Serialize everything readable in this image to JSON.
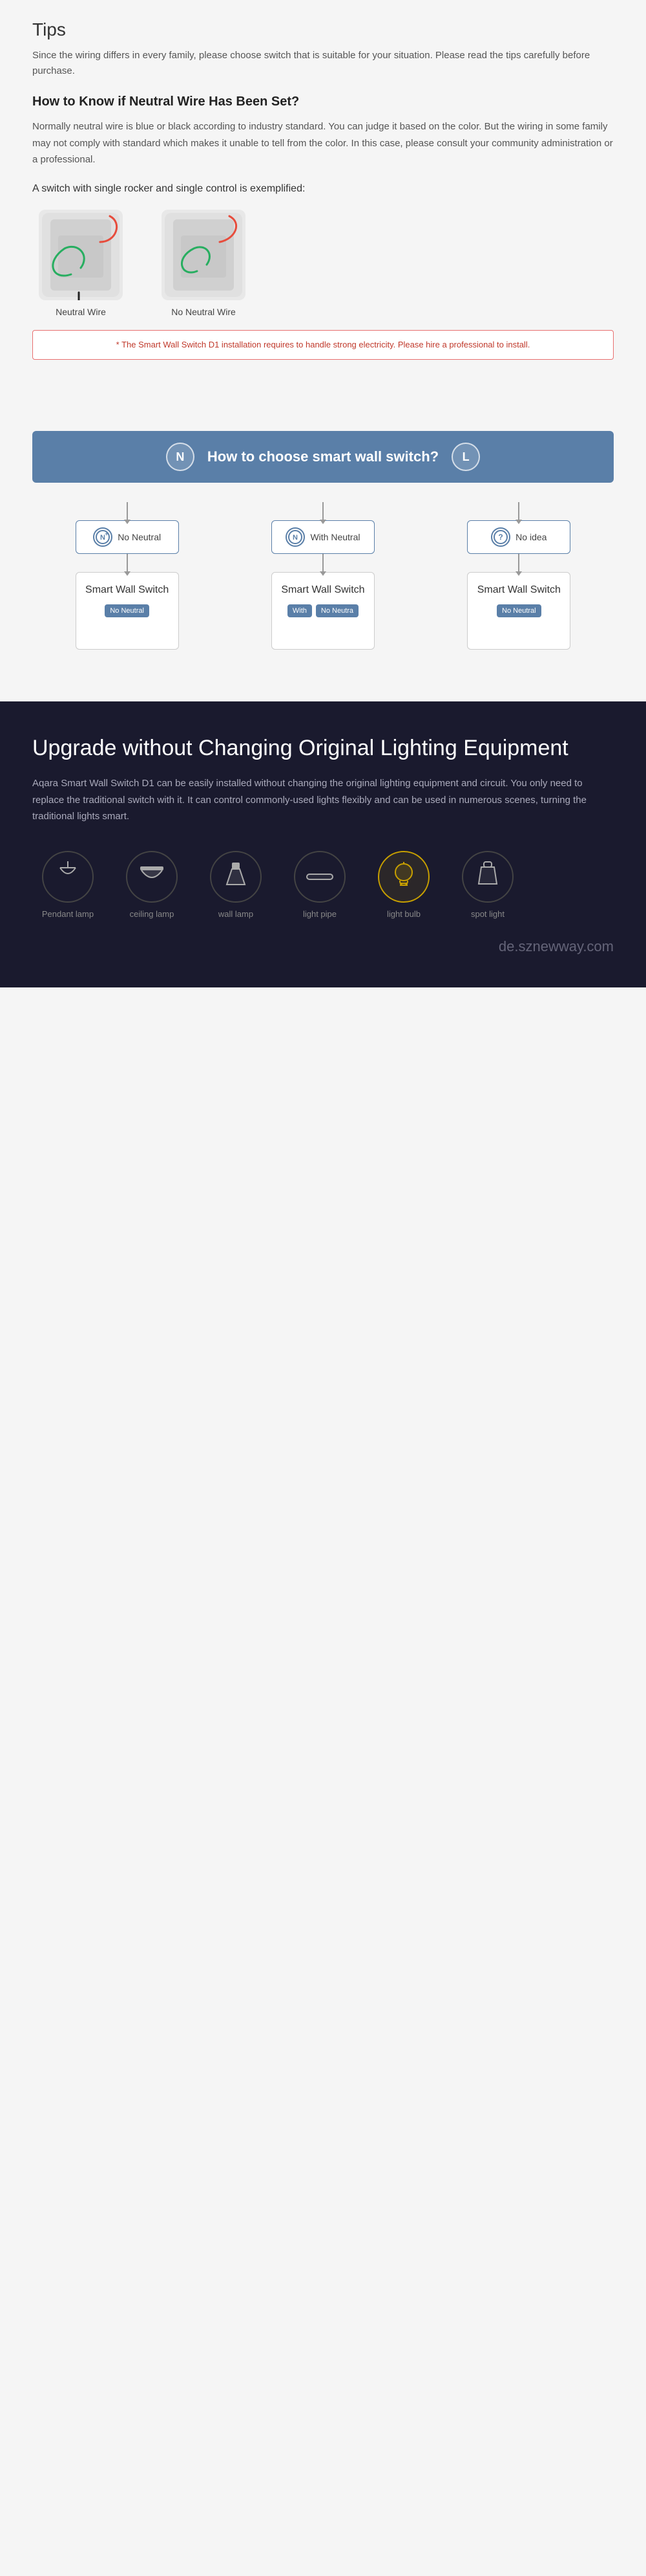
{
  "tips": {
    "title": "Tips",
    "intro": "Since the wiring differs in every family, please choose switch that is suitable for your situation. Please read the tips carefully before purchase.",
    "subtitle": "How to Know if Neutral Wire Has Been Set?",
    "body": "Normally neutral wire is blue or black according to industry standard. You can judge it based on the color. But the wiring in some family may not comply with standard which makes it unable to tell from the color. In this case, please consult your community administration or a professional.",
    "example_title": "A switch with single rocker and single control is exemplified:",
    "neutral_label": "Neutral Wire",
    "no_neutral_label": "No Neutral Wire",
    "warning": "* The Smart Wall Switch D1 installation requires to handle strong electricity. Please hire a professional to install."
  },
  "choose": {
    "banner_title": "How to choose smart wall switch?",
    "n_letter": "N",
    "l_letter": "L",
    "options": [
      {
        "id": "no-neutral",
        "icon": "N+",
        "label": "No Neutral"
      },
      {
        "id": "with-neutral",
        "icon": "N",
        "label": "With Neutral"
      },
      {
        "id": "no-idea",
        "icon": "?",
        "label": "No idea"
      }
    ],
    "products": [
      {
        "name": "Smart Wall Switch",
        "tags": [
          "No Neutral"
        ]
      },
      {
        "name": "Smart Wall Switch",
        "tags": [
          "With",
          "No Neutra"
        ]
      },
      {
        "name": "Smart Wall Switch",
        "tags": [
          "No Neutral"
        ]
      }
    ]
  },
  "upgrade": {
    "title": "Upgrade without Changing Original Lighting Equipment",
    "body": "Aqara Smart Wall Switch D1 can be easily installed without changing the original lighting equipment and circuit. You only need to replace the traditional switch with it. It can control commonly-used lights flexibly and can be used in numerous scenes, turning the traditional lights smart.",
    "lights": [
      {
        "id": "pendant",
        "label": "Pendant lamp",
        "active": false,
        "icon": "💡"
      },
      {
        "id": "ceiling",
        "label": "ceiling lamp",
        "active": false,
        "icon": "🔆"
      },
      {
        "id": "wall",
        "label": "wall lamp",
        "active": false,
        "icon": "🏮"
      },
      {
        "id": "pipe",
        "label": "light pipe",
        "active": false,
        "icon": "—"
      },
      {
        "id": "bulb",
        "label": "light bulb",
        "active": true,
        "icon": "💡"
      },
      {
        "id": "spot",
        "label": "spot light",
        "active": false,
        "icon": "🔦"
      }
    ]
  },
  "watermark": {
    "text": "de.sznewway.com"
  }
}
